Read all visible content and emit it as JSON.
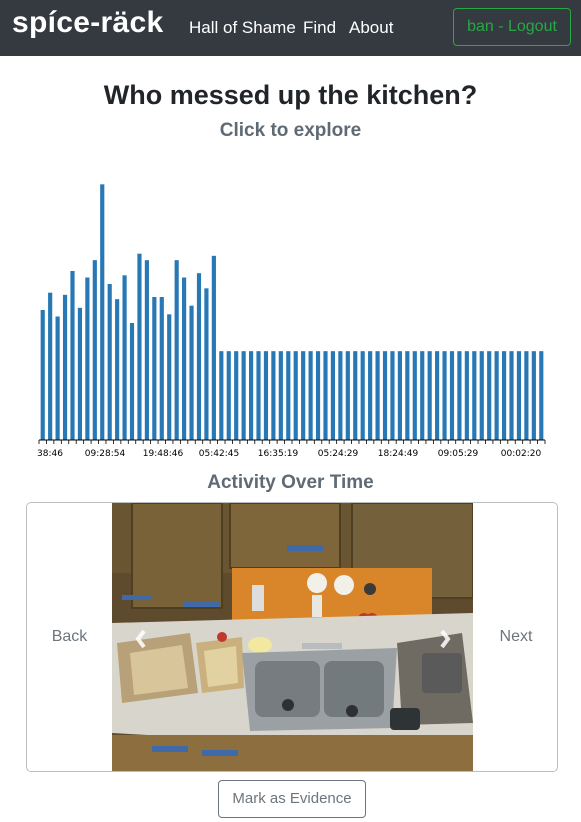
{
  "nav": {
    "brand": "spíce-räck",
    "links": [
      "Hall of Shame",
      "Find",
      "About"
    ],
    "logout_label": "ban - Logout"
  },
  "header": {
    "title": "Who messed up the kitchen?",
    "subtitle": "Click to explore"
  },
  "chart_data": {
    "type": "bar",
    "title": "Activity Over Time",
    "bar_color": "#2878b5",
    "tick_labels": [
      "38:46",
      "09:28:54",
      "19:48:46",
      "05:42:45",
      "16:35:19",
      "05:24:29",
      "18:24:49",
      "09:05:29",
      "00:02:20"
    ],
    "values": [
      60,
      68,
      57,
      67,
      78,
      61,
      75,
      83,
      118,
      72,
      65,
      76,
      54,
      86,
      83,
      66,
      66,
      58,
      83,
      75,
      62,
      77,
      70,
      85,
      41,
      41,
      41,
      41,
      41,
      41,
      41,
      41,
      41,
      41,
      41,
      41,
      41,
      41,
      41,
      41,
      41,
      41,
      41,
      41,
      41,
      41,
      41,
      41,
      41,
      41,
      41,
      41,
      41,
      41,
      41,
      41,
      41,
      41,
      41,
      41,
      41,
      41,
      41,
      41,
      41,
      41,
      41,
      41
    ]
  },
  "carousel": {
    "back_label": "Back",
    "next_label": "Next",
    "image_alt": "Kitchen sink with dirty dishes and food trays on the counter"
  },
  "evidence_label": "Mark as Evidence"
}
